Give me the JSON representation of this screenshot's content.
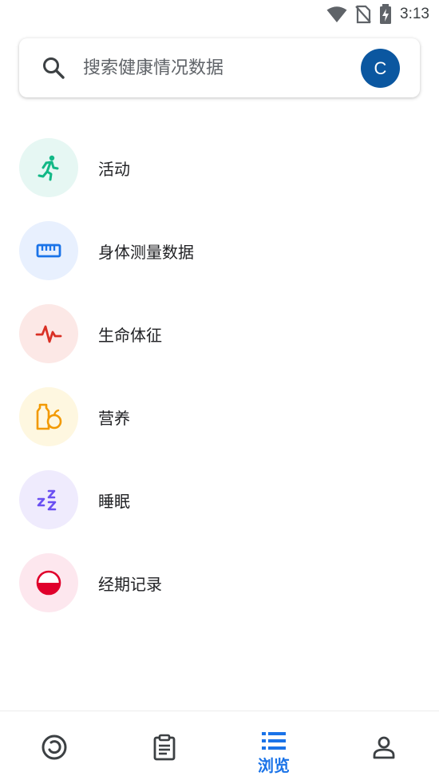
{
  "status_bar": {
    "time": "3:13",
    "icons": [
      "wifi-icon",
      "no-sim-icon",
      "battery-charging-icon"
    ]
  },
  "search": {
    "placeholder": "搜索健康情况数据",
    "avatar_initial": "C",
    "avatar_color": "#0b57a0"
  },
  "categories": [
    {
      "label": "活动",
      "icon": "running-person-icon",
      "bg": "#e6f7f3",
      "color": "#12b886"
    },
    {
      "label": "身体测量数据",
      "icon": "ruler-icon",
      "bg": "#e8f0fe",
      "color": "#1a73e8"
    },
    {
      "label": "生命体征",
      "icon": "heartbeat-icon",
      "bg": "#fce8e6",
      "color": "#d93025"
    },
    {
      "label": "营养",
      "icon": "nutrition-icon",
      "bg": "#fef7e0",
      "color": "#f29900"
    },
    {
      "label": "睡眠",
      "icon": "zzz-icon",
      "bg": "#efebfd",
      "color": "#6a4ff2"
    },
    {
      "label": "经期记录",
      "icon": "cycle-icon",
      "bg": "#fde7ee",
      "color": "#e0002b"
    }
  ],
  "bottom_nav": {
    "active_label": "浏览",
    "items": [
      "today-icon",
      "clipboard-icon",
      "browse-list-icon",
      "profile-icon"
    ],
    "active_color": "#1a73e8"
  }
}
